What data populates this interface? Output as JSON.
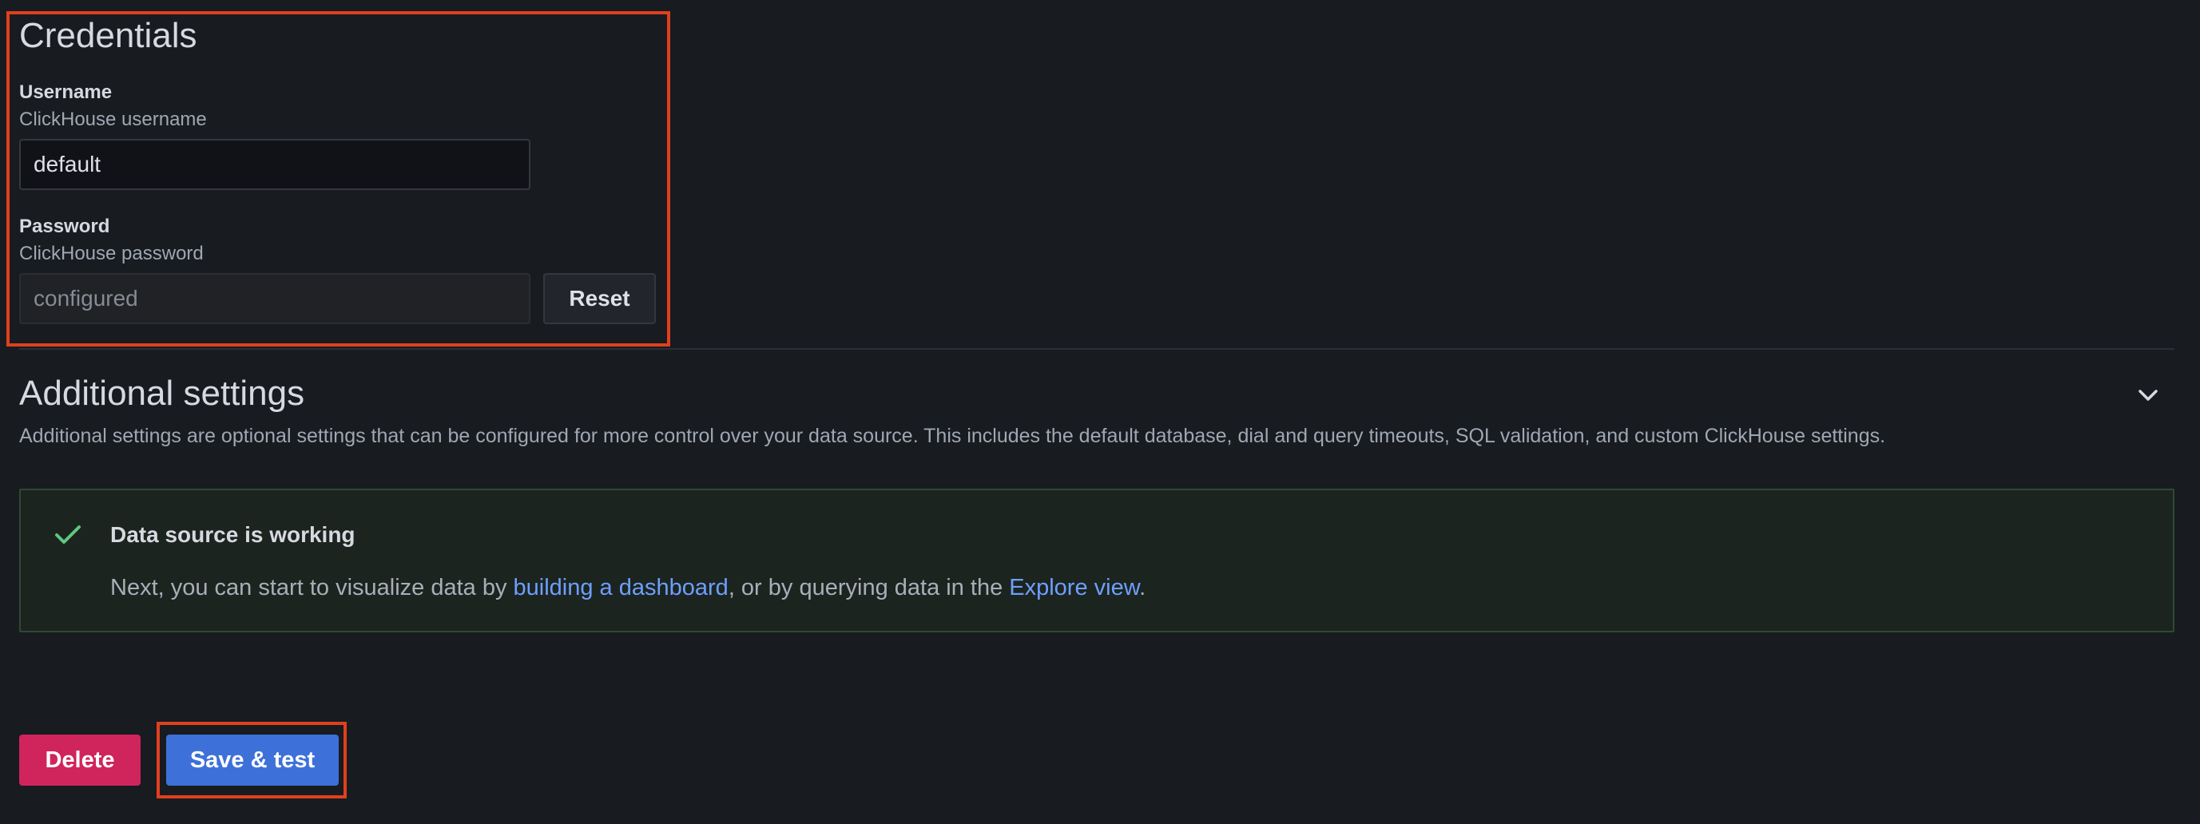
{
  "credentials": {
    "title": "Credentials",
    "username": {
      "label": "Username",
      "description": "ClickHouse username",
      "value": "default"
    },
    "password": {
      "label": "Password",
      "description": "ClickHouse password",
      "value": "configured",
      "reset_label": "Reset"
    }
  },
  "additional_settings": {
    "title": "Additional settings",
    "description": "Additional settings are optional settings that can be configured for more control over your data source. This includes the default database, dial and query timeouts, SQL validation, and custom ClickHouse settings.",
    "expand_icon": "chevron-down-icon"
  },
  "alert": {
    "status_icon": "check-icon",
    "title": "Data source is working",
    "text_before": "Next, you can start to visualize data by ",
    "link_dashboard": "building a dashboard",
    "text_middle": ", or by querying data in the ",
    "link_explore": "Explore view",
    "text_after": "."
  },
  "actions": {
    "delete_label": "Delete",
    "save_label": "Save & test"
  },
  "colors": {
    "highlight": "#e0401e",
    "success": "#5fc77f",
    "link": "#6e9fff",
    "danger": "#d0245c",
    "primary": "#3d71d9"
  }
}
